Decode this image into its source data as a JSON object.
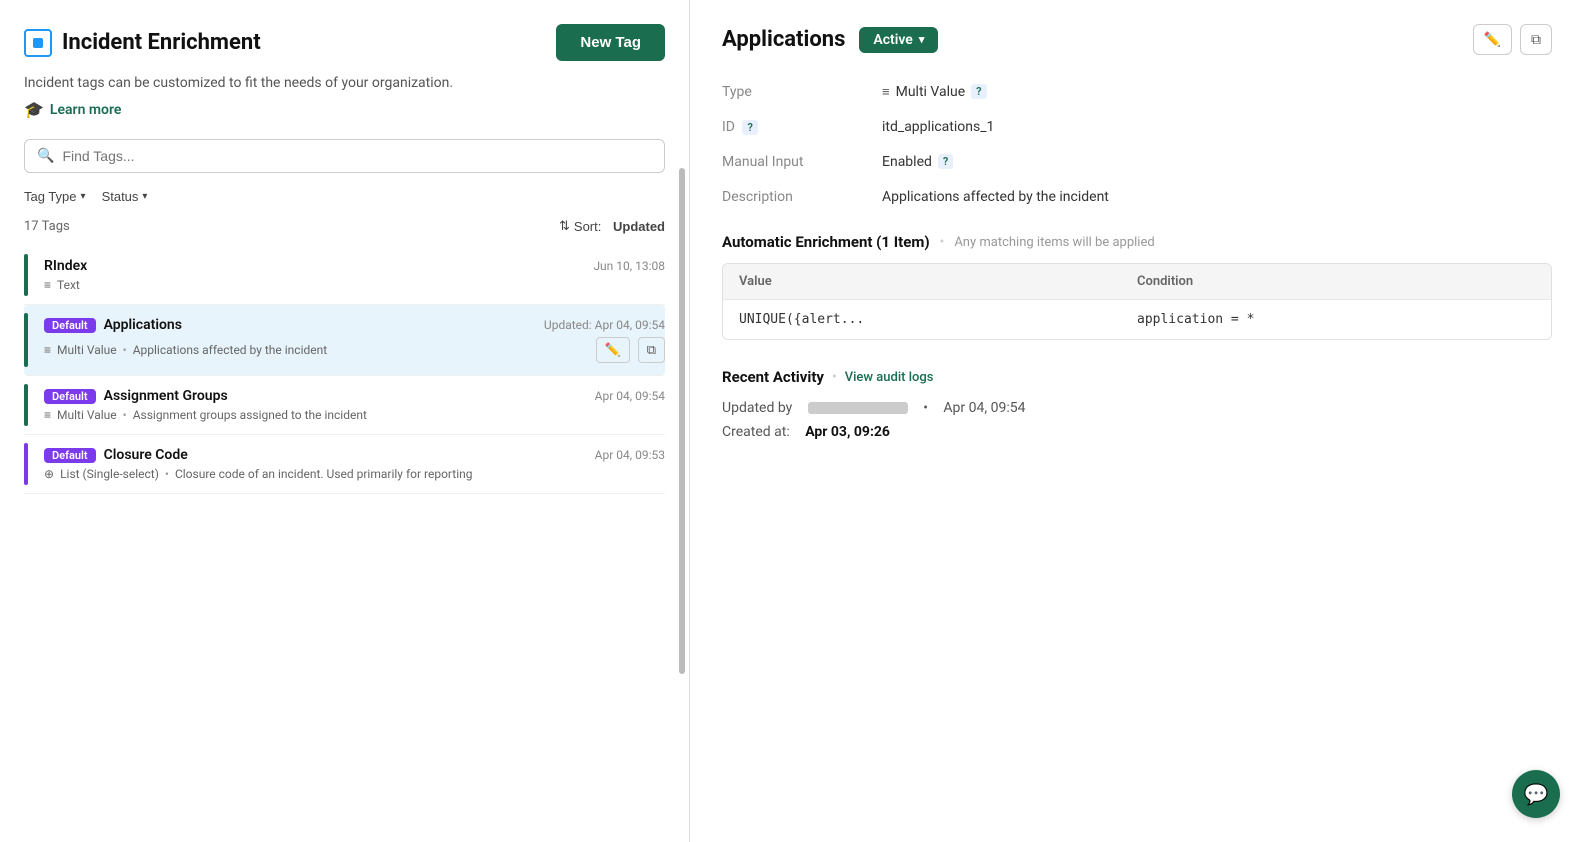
{
  "app": {
    "title": "Incident Enrichment",
    "subtitle": "Incident tags can be customized to fit the needs of your organization.",
    "learn_more": "Learn more",
    "new_tag_label": "New Tag"
  },
  "search": {
    "placeholder": "Find Tags..."
  },
  "filters": {
    "tag_type_label": "Tag Type",
    "status_label": "Status"
  },
  "tags_meta": {
    "count_label": "17 Tags",
    "sort_prefix": "Sort:",
    "sort_value": "Updated"
  },
  "tags": [
    {
      "name": "RIndex",
      "badge": null,
      "type_icon": "≡",
      "type": "Text",
      "description": "",
      "timestamp": "Jun 10, 13:08",
      "accent": "green",
      "selected": false
    },
    {
      "name": "Applications",
      "badge": "Default",
      "type_icon": "≡",
      "type": "Multi Value",
      "description": "Applications affected by the incident",
      "timestamp": "Updated: Apr 04, 09:54",
      "accent": "green",
      "selected": true
    },
    {
      "name": "Assignment Groups",
      "badge": "Default",
      "type_icon": "≡",
      "type": "Multi Value",
      "description": "Assignment groups assigned to the incident",
      "timestamp": "Apr 04, 09:54",
      "accent": "green",
      "selected": false
    },
    {
      "name": "Closure Code",
      "badge": "Default",
      "type_icon": "⊕",
      "type": "List (Single-select)",
      "description": "Closure code of an incident. Used primarily for reporting",
      "timestamp": "Apr 04, 09:53",
      "accent": "purple",
      "selected": false
    }
  ],
  "detail": {
    "title": "Applications",
    "status": "Active",
    "type_label": "Type",
    "type_icon": "≡",
    "type_value": "Multi Value",
    "type_help": "?",
    "id_label": "ID",
    "id_help": "?",
    "id_value": "itd_applications_1",
    "manual_input_label": "Manual Input",
    "manual_input_value": "Enabled",
    "manual_input_help": "?",
    "description_label": "Description",
    "description_value": "Applications affected by the incident",
    "enrichment_title": "Automatic Enrichment (1 Item)",
    "enrichment_subtitle": "Any matching items will be applied",
    "table": {
      "col_value": "Value",
      "col_condition": "Condition",
      "rows": [
        {
          "value": "UNIQUE({alert...",
          "condition": "application = *"
        }
      ]
    },
    "activity_title": "Recent Activity",
    "activity_link": "View audit logs",
    "updated_prefix": "Updated by",
    "updated_timestamp": "Apr 04, 09:54",
    "created_prefix": "Created at:",
    "created_timestamp": "Apr 03, 09:26"
  },
  "icons": {
    "search": "🔍",
    "edit": "✏️",
    "copy": "⧉",
    "chat": "💬",
    "sort": "⇅",
    "learn": "🎓"
  }
}
